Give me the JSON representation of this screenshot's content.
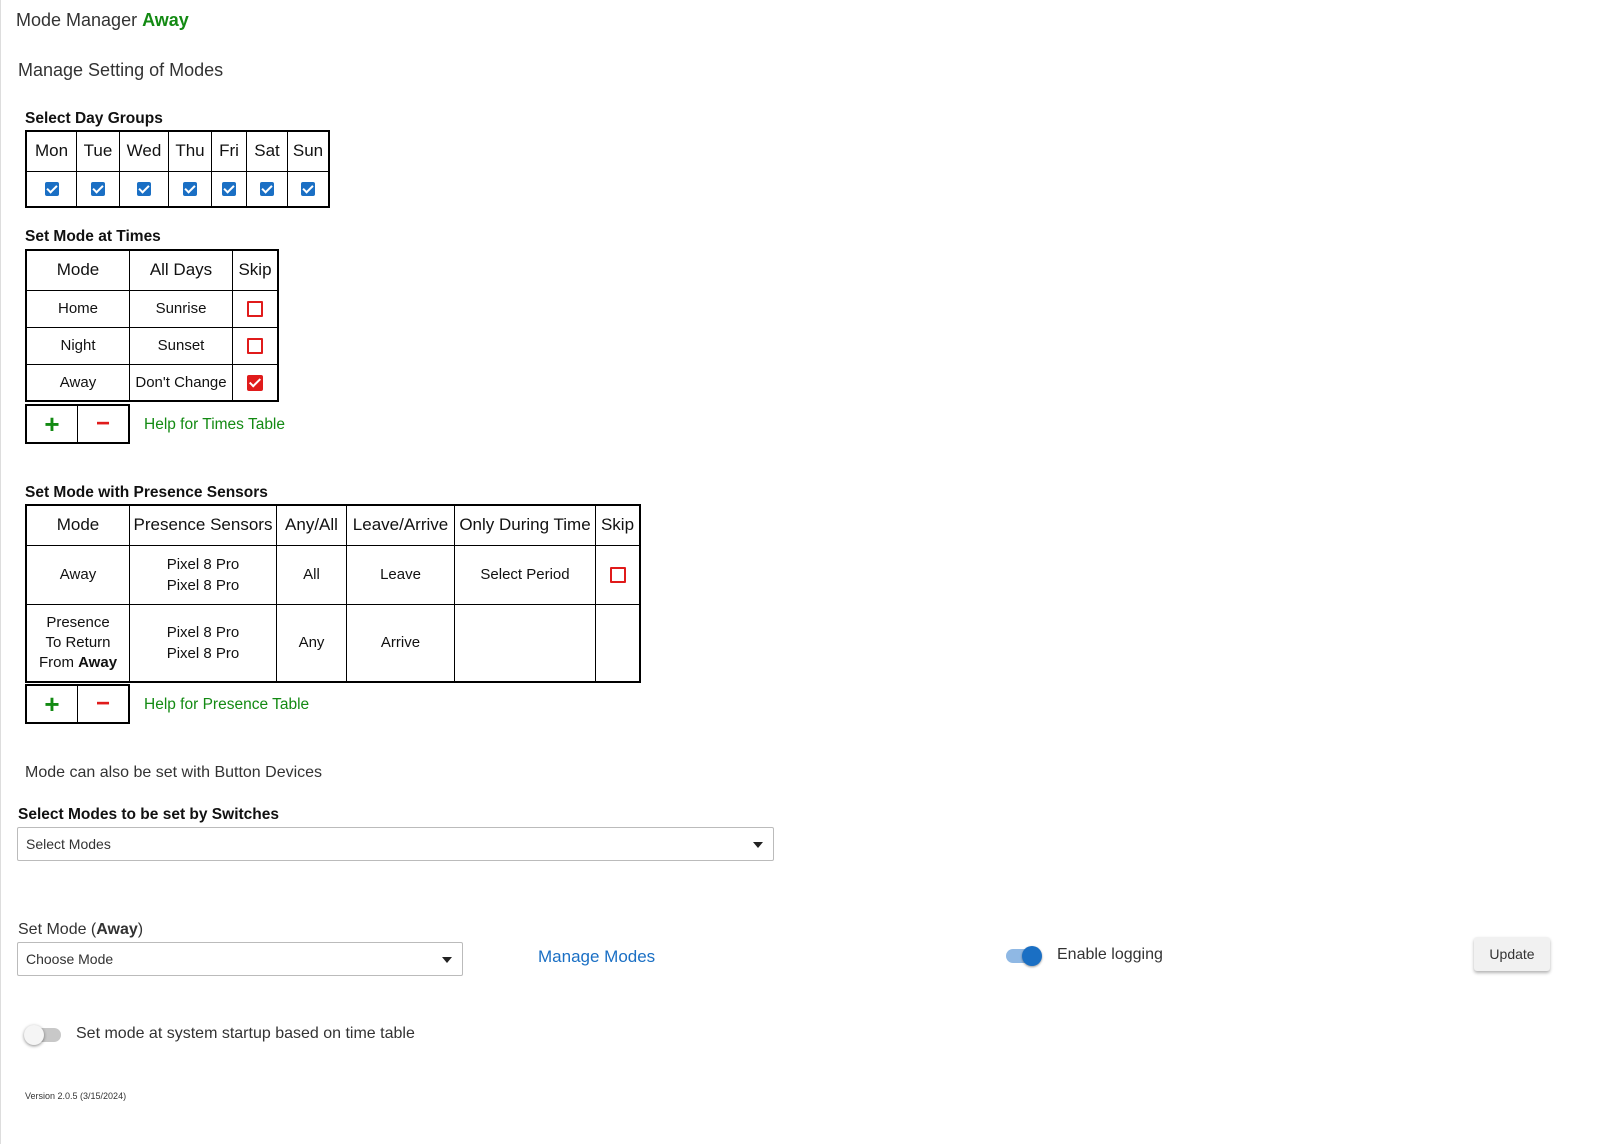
{
  "header": {
    "app_title": "Mode Manager",
    "current_mode": "Away",
    "subtitle": "Manage Setting of Modes"
  },
  "day_groups": {
    "label": "Select Day Groups",
    "days": [
      "Mon",
      "Tue",
      "Wed",
      "Thu",
      "Fri",
      "Sat",
      "Sun"
    ],
    "checked": [
      true,
      true,
      true,
      true,
      true,
      true,
      true
    ]
  },
  "times_table": {
    "label": "Set Mode at Times",
    "headers": {
      "mode": "Mode",
      "all_days": "All Days",
      "skip": "Skip"
    },
    "rows": [
      {
        "mode": "Home",
        "time": "Sunrise",
        "skip": false
      },
      {
        "mode": "Night",
        "time": "Sunset",
        "skip": false
      },
      {
        "mode": "Away",
        "time": "Don't Change",
        "skip": true
      }
    ],
    "add_label": "+",
    "remove_label": "−",
    "help_link": "Help for Times Table"
  },
  "presence_table": {
    "label": "Set Mode with Presence Sensors",
    "headers": {
      "mode": "Mode",
      "sensors": "Presence Sensors",
      "any_all": "Any/All",
      "leave_arrive": "Leave/Arrive",
      "only_during": "Only During Time",
      "skip": "Skip"
    },
    "rows": [
      {
        "mode": "Away",
        "sensor_1": "Pixel 8 Pro",
        "sensor_2": "Pixel 8 Pro",
        "any_all": "All",
        "leave_arrive": "Leave",
        "only_during": "Select Period",
        "skip": false
      },
      {
        "mode_line_1": "Presence",
        "mode_line_2": "To Return",
        "mode_line_3_prefix": "From",
        "mode_line_3_bold": "Away",
        "sensor_1": "Pixel 8 Pro",
        "sensor_2": "Pixel 8 Pro",
        "any_all": "Any",
        "leave_arrive": "Arrive"
      }
    ],
    "add_label": "+",
    "remove_label": "−",
    "help_link": "Help for Presence Table"
  },
  "button_devices_note": "Mode can also be set with Button Devices",
  "switch_modes": {
    "label": "Select Modes to be set by Switches",
    "placeholder": "Select Modes"
  },
  "set_mode": {
    "label_prefix": "Set Mode (",
    "label_mode": "Away",
    "label_suffix": ")",
    "placeholder": "Choose Mode"
  },
  "manage_modes_link": "Manage Modes",
  "logging": {
    "label": "Enable logging",
    "enabled": true
  },
  "update_button": "Update",
  "startup_toggle": {
    "label": "Set mode at system startup based on time table",
    "enabled": false
  },
  "version": "Version 2.0.5 (3/15/2024)",
  "colors": {
    "accent_blue": "#1a6fc4",
    "mode_green": "#138a13",
    "away_purple": "#8a2be2",
    "skip_red": "#e01b1b"
  }
}
